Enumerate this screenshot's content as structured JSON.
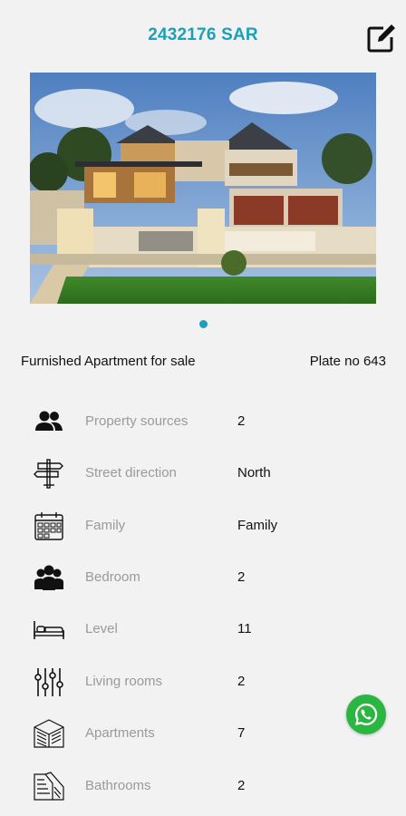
{
  "header": {
    "price": "2432176 SAR"
  },
  "listing": {
    "title": "Furnished Apartment for sale",
    "plate": "Plate no 643"
  },
  "details": [
    {
      "label": "Property sources",
      "value": "2",
      "icon": "people-icon"
    },
    {
      "label": "Street direction",
      "value": "North",
      "icon": "signpost-icon"
    },
    {
      "label": "Family",
      "value": "Family",
      "icon": "calendar-icon"
    },
    {
      "label": "Bedroom",
      "value": "2",
      "icon": "group-icon"
    },
    {
      "label": "Level",
      "value": "11",
      "icon": "bed-icon"
    },
    {
      "label": "Living rooms",
      "value": "2",
      "icon": "sliders-icon"
    },
    {
      "label": "Apartments",
      "value": "7",
      "icon": "building-icon"
    },
    {
      "label": "Bathrooms",
      "value": "2",
      "icon": "bathroom-icon"
    }
  ],
  "colors": {
    "accent": "#1aa0b8",
    "whatsapp": "#2bb642",
    "background": "#f2f2f2"
  }
}
